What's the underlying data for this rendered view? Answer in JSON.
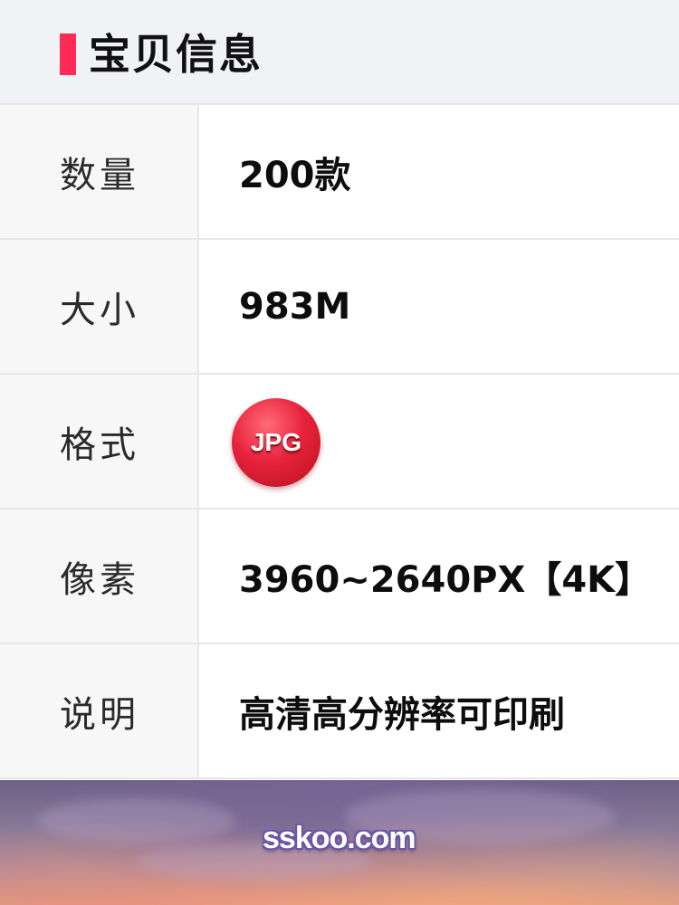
{
  "header": {
    "title": "宝贝信息",
    "accent_color": "#ff2a55"
  },
  "rows": [
    {
      "label": "数量",
      "value": "200款"
    },
    {
      "label": "大小",
      "value": "983M"
    },
    {
      "label": "格式",
      "value": "JPG",
      "icon": "jpg-badge-icon"
    },
    {
      "label": "像素",
      "value": "3960~2640PX【4K】"
    },
    {
      "label": "说明",
      "value": "高清高分辨率可印刷"
    }
  ],
  "footer_image": {
    "watermark": "sskoo.com"
  }
}
